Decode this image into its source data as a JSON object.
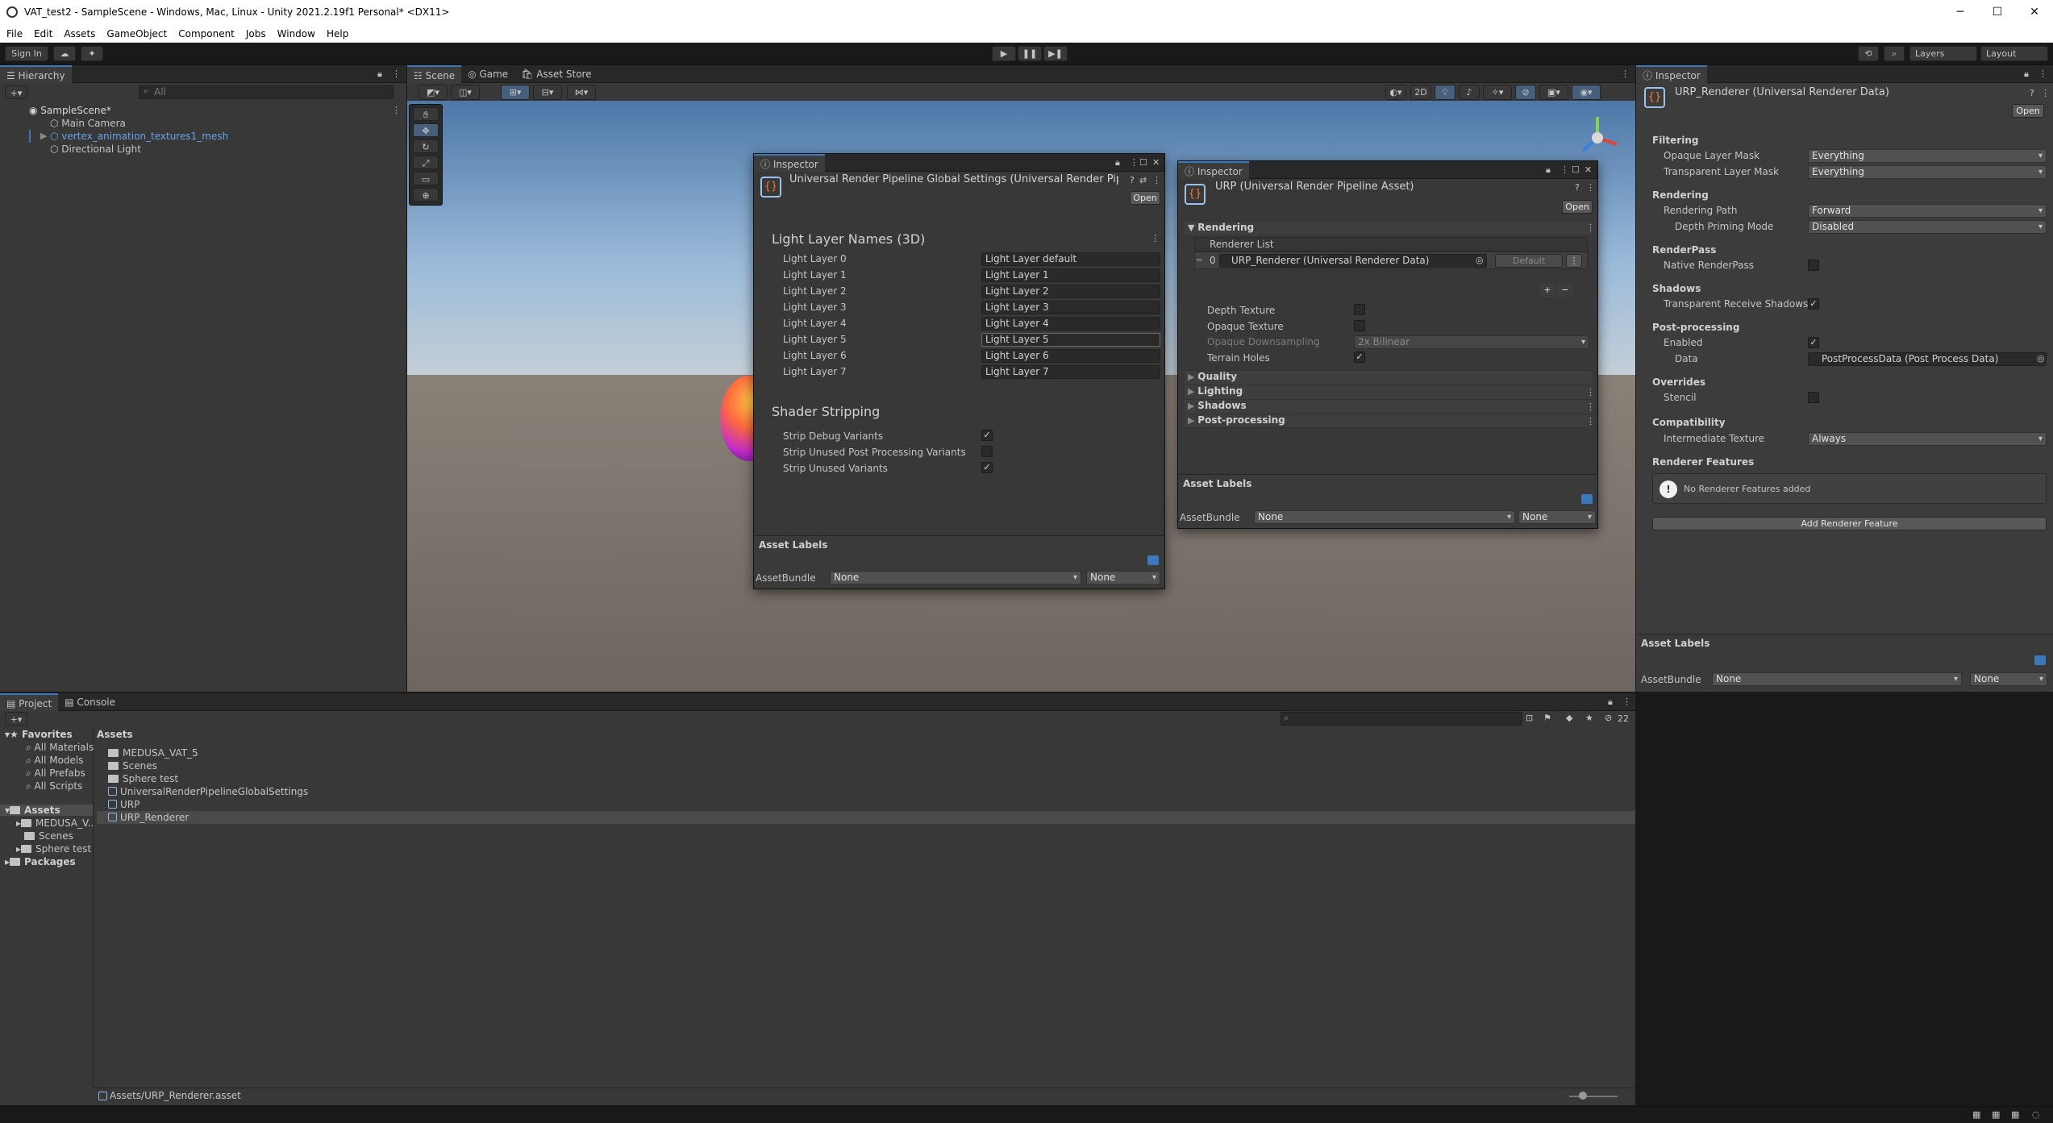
{
  "window": {
    "title": "VAT_test2 - SampleScene - Windows, Mac, Linux - Unity 2021.2.19f1 Personal* <DX11>",
    "minimize": "─",
    "maximize": "☐",
    "close": "✕"
  },
  "menu": [
    "File",
    "Edit",
    "Assets",
    "GameObject",
    "Component",
    "Jobs",
    "Window",
    "Help"
  ],
  "toolbar": {
    "sign_in": "Sign In",
    "layers": "Layers",
    "layout": "Layout",
    "play": "▶",
    "pause": "❚❚",
    "step": "▶❚"
  },
  "hierarchy": {
    "tab": "Hierarchy",
    "search_placeholder": "All",
    "scene": "SampleScene*",
    "items": [
      "Main Camera",
      "vertex_animation_textures1_mesh",
      "Directional Light"
    ]
  },
  "scene": {
    "tabs": [
      "Scene",
      "Game",
      "Asset Store"
    ],
    "mode_2d": "2D"
  },
  "inspector_global": {
    "tab": "Inspector",
    "title": "Universal Render Pipeline Global Settings (Universal Render Pipeli",
    "open": "Open",
    "light_layer_header": "Light Layer Names (3D)",
    "light_layers": [
      {
        "label": "Light Layer 0",
        "value": "Light Layer default"
      },
      {
        "label": "Light Layer 1",
        "value": "Light Layer 1"
      },
      {
        "label": "Light Layer 2",
        "value": "Light Layer 2"
      },
      {
        "label": "Light Layer 3",
        "value": "Light Layer 3"
      },
      {
        "label": "Light Layer 4",
        "value": "Light Layer 4"
      },
      {
        "label": "Light Layer 5",
        "value": "Light Layer 5"
      },
      {
        "label": "Light Layer 6",
        "value": "Light Layer 6"
      },
      {
        "label": "Light Layer 7",
        "value": "Light Layer 7"
      }
    ],
    "shader_header": "Shader Stripping",
    "shader_items": [
      {
        "label": "Strip Debug Variants",
        "checked": true
      },
      {
        "label": "Strip Unused Post Processing Variants",
        "checked": false
      },
      {
        "label": "Strip Unused Variants",
        "checked": true
      }
    ],
    "asset_labels": "Asset Labels",
    "assetbundle": "AssetBundle",
    "bundle_value": "None",
    "variant_value": "None"
  },
  "inspector_urp": {
    "tab": "Inspector",
    "title": "URP (Universal Render Pipeline Asset)",
    "open": "Open",
    "rendering": "Rendering",
    "renderer_list": "Renderer List",
    "renderer_index": "0",
    "renderer_value": "URP_Renderer (Universal Renderer Data)",
    "default_btn": "Default",
    "plus": "+",
    "minus": "−",
    "depth_texture": "Depth Texture",
    "opaque_texture": "Opaque Texture",
    "opaque_downsampling": "Opaque Downsampling",
    "downsampling_value": "2x Bilinear",
    "terrain_holes": "Terrain Holes",
    "sections": [
      "Quality",
      "Lighting",
      "Shadows",
      "Post-processing"
    ],
    "asset_labels": "Asset Labels",
    "assetbundle": "AssetBundle",
    "bundle_value": "None",
    "variant_value": "None"
  },
  "inspector_main": {
    "tab": "Inspector",
    "title": "URP_Renderer (Universal Renderer Data)",
    "open": "Open",
    "filtering": "Filtering",
    "opaque_layer_mask": "Opaque Layer Mask",
    "opaque_layer_value": "Everything",
    "transparent_layer_mask": "Transparent Layer Mask",
    "transparent_layer_value": "Everything",
    "rendering": "Rendering",
    "rendering_path": "Rendering Path",
    "rendering_path_value": "Forward",
    "depth_priming": "Depth Priming Mode",
    "depth_priming_value": "Disabled",
    "renderpass": "RenderPass",
    "native_renderpass": "Native RenderPass",
    "shadows": "Shadows",
    "transparent_receive_shadows": "Transparent Receive Shadows",
    "post_processing": "Post-processing",
    "enabled": "Enabled",
    "data": "Data",
    "data_value": "PostProcessData (Post Process Data)",
    "overrides": "Overrides",
    "stencil": "Stencil",
    "compatibility": "Compatibility",
    "intermediate_texture": "Intermediate Texture",
    "intermediate_value": "Always",
    "renderer_features": "Renderer Features",
    "no_features": "No Renderer Features added",
    "add_feature": "Add Renderer Feature",
    "asset_labels": "Asset Labels",
    "assetbundle": "AssetBundle",
    "bundle_value": "None",
    "variant_value": "None"
  },
  "project": {
    "tabs": [
      "Project",
      "Console"
    ],
    "favorites": "Favorites",
    "fav_items": [
      "All Materials",
      "All Models",
      "All Prefabs",
      "All Scripts"
    ],
    "assets_root": "Assets",
    "tree_items": [
      "MEDUSA_V...",
      "Scenes",
      "Sphere test"
    ],
    "packages": "Packages",
    "breadcrumb": "Assets",
    "files": [
      {
        "name": "MEDUSA_VAT_5",
        "type": "folder"
      },
      {
        "name": "Scenes",
        "type": "folder"
      },
      {
        "name": "Sphere test",
        "type": "folder"
      },
      {
        "name": "UniversalRenderPipelineGlobalSettings",
        "type": "asset"
      },
      {
        "name": "URP",
        "type": "asset"
      },
      {
        "name": "URP_Renderer",
        "type": "asset"
      }
    ],
    "hidden_count": "22",
    "status_path": "Assets/URP_Renderer.asset"
  }
}
